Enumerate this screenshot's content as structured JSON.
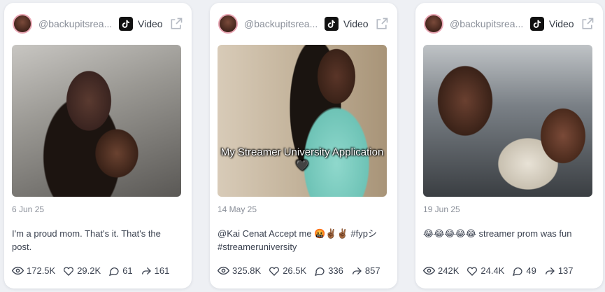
{
  "posts": [
    {
      "handle": "@backupitsrea...",
      "platform_label": "Video",
      "overlay_text": "",
      "date": "6 Jun 25",
      "caption": "I'm a proud mom. That's it. That's the post.",
      "stats": {
        "views": "172.5K",
        "likes": "29.2K",
        "comments": "61",
        "shares": "161"
      }
    },
    {
      "handle": "@backupitsrea...",
      "platform_label": "Video",
      "overlay_text": "My Streamer University Application 🖤",
      "date": "14 May 25",
      "caption": "@Kai Cenat Accept me 🤬✌🏾✌🏾 #fypシ #streameruniversity",
      "stats": {
        "views": "325.8K",
        "likes": "26.5K",
        "comments": "336",
        "shares": "857"
      }
    },
    {
      "handle": "@backupitsrea...",
      "platform_label": "Video",
      "overlay_text": "",
      "date": "19 Jun 25",
      "caption": "😂😂😂😂😂 streamer prom was fun",
      "stats": {
        "views": "242K",
        "likes": "24.4K",
        "comments": "49",
        "shares": "137"
      }
    }
  ],
  "icons": {
    "platform": "tiktok-icon",
    "external": "external-link-icon",
    "views": "eye-icon",
    "likes": "heart-icon",
    "comments": "comment-icon",
    "shares": "share-icon"
  },
  "colors": {
    "muted": "#8a8f99",
    "text": "#3b4250",
    "card": "#ffffff",
    "bg": "#eef0f4"
  }
}
